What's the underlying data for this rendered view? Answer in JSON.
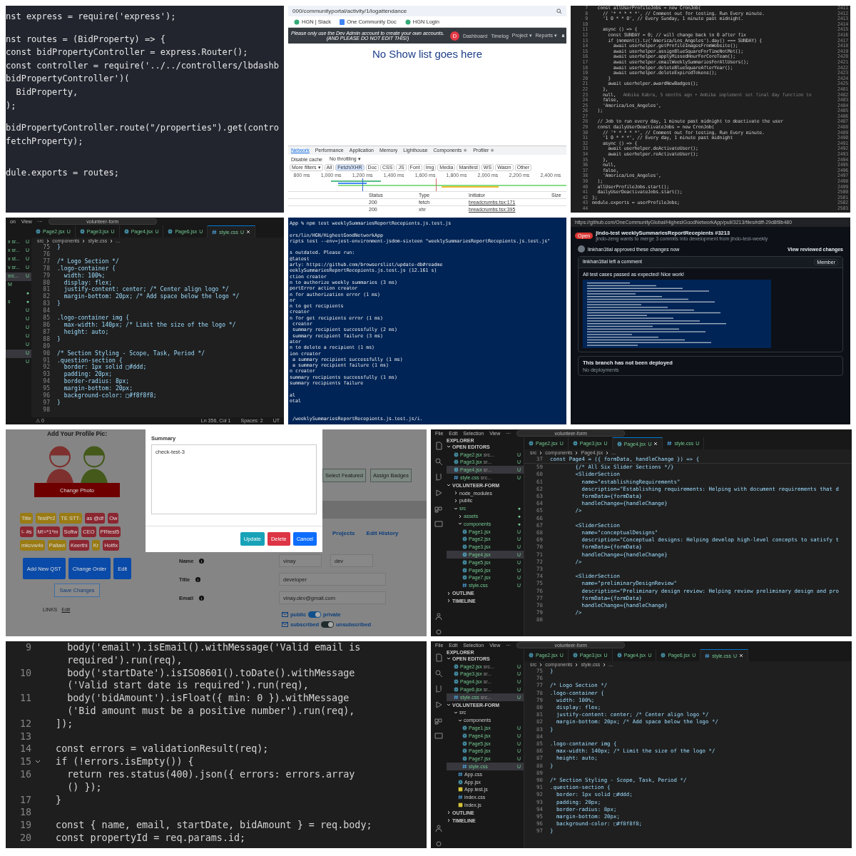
{
  "panels": [
    {
      "kind": "code",
      "lines": [
        {
          "text": "nst express = require('express');"
        },
        {
          "kind": "blank"
        },
        {
          "text": "nst routes = (BidProperty) => {"
        },
        {
          "text": "const bidPropertyController = express.Router();"
        },
        {
          "text": "const controller = require('../../controllers/lbdashb"
        },
        {
          "text": "bidPropertyController')("
        },
        {
          "text": "  BidProperty,"
        },
        {
          "text": ");"
        },
        {
          "kind": "blank"
        },
        {
          "text": "bidPropertyController.route(\"/properties\").get(contro"
        },
        {
          "text": "fetchProperty);"
        },
        {
          "kind": "blank"
        },
        {
          "kind": "blank"
        },
        {
          "text": "dule.exports = routes;"
        }
      ]
    },
    {
      "kind": "browser",
      "url": "000/communityportal/activity/1/logattendance",
      "bookmarks": [
        {
          "label": "HGN | Slack",
          "kind": "globe"
        },
        {
          "label": "One Community Doc",
          "kind": "doc"
        },
        {
          "label": "HGN Login",
          "kind": "globe"
        }
      ],
      "notice": [
        "Please only use the Dev Admin account to create your own accounts.",
        "(AND PLEASE DO NOT EDIT THIS!)"
      ],
      "avatar": "D",
      "nav": [
        "Dashboard",
        "Timelog",
        "Project ▾",
        "Reports ▾"
      ],
      "heading": "No Show list goes here",
      "devtools_tabs": [
        {
          "label": "Network",
          "selected": true
        },
        {
          "label": "Performance",
          "selected": false
        },
        {
          "label": "Application",
          "selected": false
        },
        {
          "label": "Memory",
          "selected": false
        },
        {
          "label": "Lighthouse",
          "selected": false
        },
        {
          "label": "Components ⚛",
          "selected": false
        },
        {
          "label": "Profiler ⚛",
          "selected": false
        }
      ],
      "toolbar": [
        "Disable cache",
        "No throttling ▾"
      ],
      "filters": [
        {
          "label": "More filters ▾",
          "selected": false
        },
        {
          "label": "All",
          "selected": false
        },
        {
          "label": "Fetch/XHR",
          "selected": true
        },
        {
          "label": "Doc",
          "selected": false
        },
        {
          "label": "CSS",
          "selected": false
        },
        {
          "label": "JS",
          "selected": false
        },
        {
          "label": "Font",
          "selected": false
        },
        {
          "label": "Img",
          "selected": false
        },
        {
          "label": "Media",
          "selected": false
        },
        {
          "label": "Manifest",
          "selected": false
        },
        {
          "label": "WS",
          "selected": false
        },
        {
          "label": "Wasm",
          "selected": false
        },
        {
          "label": "Other",
          "selected": false
        }
      ],
      "timeline": [
        "800 ms",
        "1,000 ms",
        "1,200 ms",
        "1,400 ms",
        "1,600 ms",
        "1,800 ms",
        "2,000 ms",
        "2,200 ms",
        "2,400 ms"
      ],
      "columns": [
        "Status",
        "Type",
        "Initiator",
        "Size"
      ],
      "rows": [
        [
          "200",
          "fetch",
          "breadcrumbs.tsx:171"
        ],
        [
          "200",
          "xhr",
          "breadcrumbs.tsx:395"
        ]
      ]
    },
    {
      "kind": "code",
      "lines": [
        {
          "n": "7",
          "text": "  const allUserProfileJobs = new CronJob(",
          "aux": "2411"
        },
        {
          "n": "8",
          "text": "    // '* * * * *', // Comment out for testing. Run Every minute.",
          "aux": "2412"
        },
        {
          "n": "9",
          "text": "    '1 0 * * 0', // Every Sunday, 1 minute past midnight.",
          "aux": "2413"
        },
        {
          "n": "10",
          "aux": "2414"
        },
        {
          "n": "11",
          "text": "    async () => {",
          "aux": "2415"
        },
        {
          "n": "12",
          "text": "      const SUNDAY = 0; // will change back to 0 after fix",
          "aux": "2416"
        },
        {
          "n": "13",
          "text": "      if (moment().tz('America/Los_Angeles').day() === SUNDAY) {",
          "aux": "2417"
        },
        {
          "n": "14",
          "text": "        await userhelper.getProfileImagesFromWebsite();",
          "aux": "2418"
        },
        {
          "n": "15",
          "text": "        await userhelper.assignBlueSquareForTimeNotMet();",
          "aux": "2419"
        },
        {
          "n": "16",
          "text": "        await userhelper.applyMissedHourForCoreTeam();",
          "aux": "2420"
        },
        {
          "n": "17",
          "text": "        await userhelper.emailWeeklySummariesForAllUsers();",
          "aux": "2421"
        },
        {
          "n": "18",
          "text": "        await userhelper.deleteBlueSquareAfterYear();",
          "aux": "2422"
        },
        {
          "n": "19",
          "text": "        await userhelper.deleteExpiredTokens();",
          "aux": "2423"
        },
        {
          "n": "20",
          "text": "      }",
          "aux": "2424"
        },
        {
          "n": "21",
          "text": "      await userhelper.awardNewBadges();",
          "aux": "2425"
        },
        {
          "n": "22",
          "text": "    },",
          "aux": "2481"
        },
        {
          "n": "23",
          "text": "    null,",
          "blame": "Ambika Kabra, 5 months ago • Ambika implement set final day function to",
          "aux": "2482"
        },
        {
          "n": "24",
          "text": "    false,",
          "aux": "2483"
        },
        {
          "n": "25",
          "text": "    'America/Los_Angeles',",
          "aux": "2484"
        },
        {
          "n": "26",
          "text": "  );",
          "aux": "2485"
        },
        {
          "n": "27",
          "aux": "2486"
        },
        {
          "n": "28",
          "text": "  // Job to run every day, 1 minute past midnight to deactivate the user",
          "aux": "2487"
        },
        {
          "n": "29",
          "text": "  const dailyUserDeactivateJobs = new CronJob(",
          "aux": "2488"
        },
        {
          "n": "30",
          "text": "    // '* * * * *', // Comment out for testing. Run Every minute.",
          "aux": "2489"
        },
        {
          "n": "31",
          "text": "    '1 0 * * *', // Every day, 1 minute past midnight",
          "aux": "2490"
        },
        {
          "n": "32",
          "text": "    async () => {",
          "aux": "2491"
        },
        {
          "n": "33",
          "text": "      await userhelper.deActivateUser();",
          "aux": "2492"
        },
        {
          "n": "34",
          "text": "      await userhelper.reActivateUser();",
          "aux": "2493"
        },
        {
          "n": "35",
          "text": "    },",
          "aux": "2494"
        },
        {
          "n": "36",
          "text": "    null,",
          "aux": "2495"
        },
        {
          "n": "37",
          "text": "    false,",
          "aux": "2496"
        },
        {
          "n": "38",
          "text": "    'America/Los_Angeles',",
          "aux": "2497"
        },
        {
          "n": "39",
          "text": "  );",
          "aux": "2498"
        },
        {
          "n": "40",
          "text": "  allUserProfileJobs.start();",
          "aux": "2499"
        },
        {
          "n": "41",
          "text": "  dailyUserDeactivateJobs.start();",
          "aux": "2500"
        },
        {
          "n": "42",
          "text": "};",
          "aux": "2501"
        },
        {
          "n": "43",
          "text": "module.exports = userProfileJobs;",
          "aux": "2502"
        },
        {
          "n": "44",
          "aux": "2503"
        }
      ]
    },
    {
      "kind": "editor",
      "menu": [
        "on",
        "View",
        "···"
      ],
      "search": "volunteer-form",
      "sidebar_strip": [
        {
          "text": "x sr...",
          "status": "U",
          "selected": false
        },
        {
          "text": "x sr...",
          "status": "U",
          "selected": false
        },
        {
          "text": "x st...",
          "status": "U",
          "selected": false
        },
        {
          "text": "v sr...",
          "status": "U",
          "selected": false
        },
        {
          "text": "src...",
          "status": "U",
          "selected": true
        },
        {
          "text": "M",
          "selected": false
        },
        {
          "status": "●",
          "selected": false
        },
        {
          "text": "s",
          "status": "●",
          "selected": false
        },
        {
          "status": "U",
          "selected": false
        },
        {
          "status": "U",
          "selected": false
        },
        {
          "status": "U",
          "selected": false
        },
        {
          "status": "U",
          "selected": false
        },
        {
          "status": "U",
          "selected": false
        },
        {
          "status": "U",
          "selected": true
        },
        {
          "status": "U",
          "selected": false
        }
      ],
      "tabs": [
        {
          "label": "Page2.jsx",
          "kind": "jsx",
          "status": "U",
          "selected": false
        },
        {
          "label": "Page3.jsx",
          "kind": "jsx",
          "status": "U",
          "selected": false
        },
        {
          "label": "Page4.jsx",
          "kind": "jsx",
          "status": "U",
          "selected": false
        },
        {
          "label": "Page6.jsx",
          "kind": "jsx",
          "status": "U",
          "selected": false
        },
        {
          "label": "style.css",
          "kind": "css",
          "status": "U",
          "selected": true
        }
      ],
      "breadcrumb": [
        "src",
        "components",
        "style.css",
        "..."
      ],
      "lines": [
        {
          "n": "75",
          "text": "}"
        },
        {
          "n": "76"
        },
        {
          "n": "77",
          "text": "/* Logo Section */"
        },
        {
          "n": "78",
          "text": ".logo-container {"
        },
        {
          "n": "79",
          "text": "  width: 100%;"
        },
        {
          "n": "80",
          "text": "  display: flex;"
        },
        {
          "n": "81",
          "text": "  justify-content: center; /* Center align logo */"
        },
        {
          "n": "82",
          "text": "  margin-bottom: 20px; /* Add space below the logo */"
        },
        {
          "n": "83",
          "text": "}"
        },
        {
          "n": "84"
        },
        {
          "n": "85",
          "text": ".logo-container img {"
        },
        {
          "n": "86",
          "text": "  max-width: 140px; /* Limit the size of the logo */"
        },
        {
          "n": "87",
          "text": "  height: auto;"
        },
        {
          "n": "88",
          "text": "}"
        },
        {
          "n": "89"
        },
        {
          "n": "90",
          "text": "/* Section Styling - Scope, Task, Period */"
        },
        {
          "n": "91",
          "text": ".question-section {"
        },
        {
          "n": "92",
          "text": "  border: 1px solid □#ddd;"
        },
        {
          "n": "93",
          "text": "  padding: 20px;"
        },
        {
          "n": "94",
          "text": "  border-radius: 8px;"
        },
        {
          "n": "95",
          "text": "  margin-bottom: 20px;"
        },
        {
          "n": "96",
          "text": "  background-color: □#f8f8f8;"
        },
        {
          "n": "97",
          "text": "}"
        },
        {
          "n": "98"
        }
      ],
      "status_bar": [
        "⚠ 0",
        "Ln 356, Col 1",
        "Spaces: 2",
        "UT"
      ]
    },
    {
      "kind": "terminal",
      "lines": [
        {
          "text": "App % npm test weeklySummariesReportRecepients.js.test.js"
        },
        {
          "kind": "blank"
        },
        {
          "text": "ers/lin/HGN/HighestGoodNetworkApp"
        },
        {
          "text": "ripts test --env=jest-environment-jsdom-sixteen \"weeklySummariesReportRecepients.js.test.js\""
        },
        {
          "kind": "blank"
        },
        {
          "text": "s outdated. Please run:"
        },
        {
          "text": "@latest"
        },
        {
          "text": "arly: https://github.com/browserslist/update-db#readme"
        },
        {
          "text": "eeklySummariesReportRecepients.js.test.js (12.161 s)"
        },
        {
          "text": "ction creator"
        },
        {
          "text": "n to authorize weekly summaries (3 ms)"
        },
        {
          "text": "portError action creator"
        },
        {
          "text": "n for authorization error (1 ms)"
        },
        {
          "text": "or"
        },
        {
          "text": "n to get recipients"
        },
        {
          "text": "creator"
        },
        {
          "text": "n for get recipients error (1 ms)"
        },
        {
          "text": " creator"
        },
        {
          "text": " summary recipient successfully (2 ms)"
        },
        {
          "text": " summary recipient failure (3 ms)"
        },
        {
          "text": "ator"
        },
        {
          "text": "n to delete a recipient (1 ms)"
        },
        {
          "text": "ion creator"
        },
        {
          "text": " a summary recipient successfully (1 ms)"
        },
        {
          "text": " a summary recipient failure (1 ms)"
        },
        {
          "text": "n creator"
        },
        {
          "text": "summary recipients successfully (1 ms)"
        },
        {
          "text": "summary recipients failure"
        },
        {
          "kind": "blank"
        },
        {
          "text": "al"
        },
        {
          "text": "otal"
        },
        {
          "kind": "blank"
        },
        {
          "kind": "blank"
        },
        {
          "text": " /weeklySummariesReportRecepients.js.test.js/i."
        }
      ]
    },
    {
      "kind": "github",
      "url": "https://github.com/OneCommunityGlobal/HighestGoodNetworkApp/pull/3213/files#diff-29d8f8b480",
      "state": "Open",
      "title": "jindo-test weeklySummariesReportRecepients #3213",
      "subtitle": "jindo-zeng wants to merge 3 commits into development from jindo-test-weekly",
      "approval": "linkhan1tial approved these changes now",
      "review_link": "View reviewed changes",
      "comment_author": "linkhan1tial left a comment",
      "role": "Member",
      "comment": "All test cases passed as expected! Nice work!",
      "deploy_title": "This branch has not been deployed",
      "deploy_sub": "No deployments"
    },
    {
      "kind": "profile",
      "pic_title": "Add Your Profile Pic:",
      "change_photo": "Change Photo",
      "tags": [
        {
          "label": "Title",
          "color": "#9a7b14"
        },
        {
          "label": "TestPr2",
          "color": "#9a7b14"
        },
        {
          "label": "TE STT-",
          "color": "#9a7b14"
        },
        {
          "label": "as @df",
          "color": "#8b2631"
        },
        {
          "label": "Ow",
          "color": "#8b2631"
        },
        {
          "label": "!- #s",
          "color": "#8b2631"
        },
        {
          "label": "M!=*1*m",
          "color": "#8b2631"
        },
        {
          "label": "Softw",
          "color": "#8b2631"
        },
        {
          "label": "CEO",
          "color": "#8b2631"
        },
        {
          "label": "PRtest5",
          "color": "#8b2631"
        },
        {
          "label": "mkcvw4x",
          "color": "#9a7b14"
        },
        {
          "label": "Pallavi",
          "color": "#9a7b14"
        },
        {
          "label": "Keerthi",
          "color": "#8b2631"
        },
        {
          "label": "Kr",
          "color": "#9a7b14"
        },
        {
          "label": "Hotfix",
          "color": "#8b2631"
        }
      ],
      "actions": [
        "Add New QST",
        "Change Order",
        "Edit"
      ],
      "save": "Save Changes",
      "links_label": "LINKS",
      "links_edit": "Edit",
      "top_buttons": [
        "Select Featured",
        "Assign Badges"
      ],
      "tabs": [
        "Projects",
        "Edit History"
      ],
      "fields": [
        {
          "label": "Name",
          "values": [
            "vinay",
            "dev"
          ]
        },
        {
          "label": "Title",
          "values": [
            "developer"
          ]
        },
        {
          "label": "Email",
          "values": [
            "vinay.dev@gmail.com"
          ]
        }
      ],
      "toggles": [
        {
          "left": "public",
          "right": "private",
          "on": true
        },
        {
          "left": "subscribed",
          "right": "unsubscribed",
          "on": true
        }
      ],
      "modal": {
        "title": "Summary",
        "value": "check-test-3",
        "buttons": [
          {
            "label": "Update",
            "kind": "info"
          },
          {
            "label": "Delete",
            "kind": "danger"
          },
          {
            "label": "Cancel",
            "kind": "primary"
          }
        ]
      }
    },
    {
      "kind": "editor",
      "menu": [
        "File",
        "Edit",
        "Selection",
        "View",
        "···"
      ],
      "search": "volunteer-form",
      "explorer": {
        "title": "EXPLORER",
        "sections": [
          {
            "label": "OPEN EDITORS",
            "expanded": true,
            "children": [
              {
                "label": "Page2.jsx",
                "hint": "src...",
                "kind": "jsx",
                "status": "U",
                "selected": false
              },
              {
                "label": "Page3.jsx",
                "hint": "sr...",
                "kind": "jsx",
                "status": "U",
                "selected": false
              },
              {
                "label": "Page4.jsx",
                "hint": "sr...",
                "kind": "jsx",
                "status": "U",
                "selected": true
              },
              {
                "label": "style.css",
                "hint": "src...",
                "kind": "css",
                "status": "U",
                "selected": false
              }
            ]
          },
          {
            "label": "VOLUNTEER-FORM",
            "expanded": true,
            "children": [
              {
                "label": "node_modules",
                "kind": "folder",
                "expanded": false
              },
              {
                "label": "public",
                "kind": "folder",
                "expanded": false
              },
              {
                "label": "src",
                "kind": "folder",
                "expanded": true,
                "status": "●",
                "children": [
                  {
                    "label": "assets",
                    "kind": "folder",
                    "expanded": false,
                    "status": "●"
                  },
                  {
                    "label": "components",
                    "kind": "folder",
                    "expanded": true,
                    "status": "●",
                    "children": [
                      {
                        "label": "Page1.jsx",
                        "kind": "jsx",
                        "status": "U",
                        "selected": false
                      },
                      {
                        "label": "Page2.jsx",
                        "kind": "jsx",
                        "status": "U",
                        "selected": false
                      },
                      {
                        "label": "Page3.jsx",
                        "kind": "jsx",
                        "status": "U",
                        "selected": false
                      },
                      {
                        "label": "Page4.jsx",
                        "kind": "jsx",
                        "status": "U",
                        "selected": true
                      },
                      {
                        "label": "Page5.jsx",
                        "kind": "jsx",
                        "status": "U",
                        "selected": false
                      },
                      {
                        "label": "Page6.jsx",
                        "kind": "jsx",
                        "status": "U",
                        "selected": false
                      },
                      {
                        "label": "Page7.jsx",
                        "kind": "jsx",
                        "status": "U",
                        "selected": false
                      },
                      {
                        "label": "style.css",
                        "kind": "css",
                        "status": "U",
                        "selected": false
                      }
                    ]
                  }
                ]
              }
            ]
          },
          {
            "label": "OUTLINE",
            "expanded": false
          },
          {
            "label": "TIMELINE",
            "expanded": false
          }
        ]
      },
      "tabs": [
        {
          "label": "Page2.jsx",
          "kind": "jsx",
          "status": "U",
          "selected": false
        },
        {
          "label": "Page3.jsx",
          "kind": "jsx",
          "status": "U",
          "selected": false
        },
        {
          "label": "Page4.jsx",
          "kind": "jsx",
          "status": "U",
          "selected": true
        },
        {
          "label": "style.css",
          "kind": "css",
          "status": "U",
          "selected": false
        }
      ],
      "breadcrumb": [
        "src",
        "components",
        "Page4.jsx",
        "..."
      ],
      "sticky": {
        "n": "37",
        "text": "const Page4 = ({ formData, handleChange }) => {"
      },
      "lines": [
        {
          "n": "59",
          "text": "        {/* All Six Slider Sections */}"
        },
        {
          "n": "60",
          "text": "        <SliderSection"
        },
        {
          "n": "61",
          "text": "          name=\"establishingRequirements\""
        },
        {
          "n": "62",
          "text": "          description=\"Establishing requirements: Helping with document requirements that d"
        },
        {
          "n": "63",
          "text": "          formData={formData}"
        },
        {
          "n": "64",
          "text": "          handleChange={handleChange}"
        },
        {
          "n": "65",
          "text": "        />"
        },
        {
          "n": "66"
        },
        {
          "n": "67",
          "text": "        <SliderSection"
        },
        {
          "n": "68",
          "text": "          name=\"conceptualDesigns\""
        },
        {
          "n": "69",
          "text": "          description=\"Conceptual designs: Helping develop high-level concepts to satisfy t"
        },
        {
          "n": "70",
          "text": "          formData={formData}"
        },
        {
          "n": "71",
          "text": "          handleChange={handleChange}"
        },
        {
          "n": "72",
          "text": "        />"
        },
        {
          "n": "73"
        },
        {
          "n": "74",
          "text": "        <SliderSection"
        },
        {
          "n": "75",
          "text": "          name=\"preliminaryDesignReview\""
        },
        {
          "n": "76",
          "text": "          description=\"Preliminary design review: Helping review preliminary design and pro"
        },
        {
          "n": "77",
          "text": "          formData={formData}"
        },
        {
          "n": "78",
          "text": "          handleChange={handleChange}"
        },
        {
          "n": "79",
          "text": "        />"
        },
        {
          "n": "80"
        }
      ]
    },
    {
      "kind": "code",
      "lines": [
        {
          "n": "9",
          "text": "    body('email').isEmail().withMessage('Valid email is"
        },
        {
          "text": "    required').run(req),"
        },
        {
          "n": "10",
          "text": "    body('startDate').isISO8601().toDate().withMessage"
        },
        {
          "text": "    ('Valid start date is required').run(req),"
        },
        {
          "n": "11",
          "text": "    body('bidAmount').isFloat({ min: 0 }).withMessage"
        },
        {
          "text": "    ('Bid amount must be a positive number').run(req),"
        },
        {
          "n": "12",
          "text": "  ]);"
        },
        {
          "n": "13"
        },
        {
          "n": "14",
          "text": "  const errors = validationResult(req);"
        },
        {
          "n": "15",
          "text": "  if (!errors.isEmpty()) {",
          "fold": true
        },
        {
          "n": "16",
          "text": "    return res.status(400).json({ errors: errors.array"
        },
        {
          "text": "    () });"
        },
        {
          "n": "17",
          "text": "  }"
        },
        {
          "n": "18"
        },
        {
          "n": "19",
          "text": "  const { name, email, startDate, bidAmount } = req.body;"
        },
        {
          "n": "20",
          "text": "  const propertyId = req.params.id;"
        }
      ]
    },
    {
      "kind": "editor",
      "menu": [
        "File",
        "Edit",
        "Selection",
        "View",
        "···"
      ],
      "search": "volunteer-form",
      "explorer": {
        "title": "EXPLORER",
        "sections": [
          {
            "label": "OPEN EDITORS",
            "expanded": true,
            "children": [
              {
                "label": "Page2.jsx",
                "hint": "src...",
                "kind": "jsx",
                "status": "U",
                "selected": false
              },
              {
                "label": "Page3.jsx",
                "hint": "sr...",
                "kind": "jsx",
                "status": "U",
                "selected": false
              },
              {
                "label": "Page4.jsx",
                "hint": "sr...",
                "kind": "jsx",
                "status": "U",
                "selected": false
              },
              {
                "label": "Page6.jsx",
                "hint": "sr...",
                "kind": "jsx",
                "status": "U",
                "selected": false
              },
              {
                "label": "style.css",
                "hint": "src...",
                "kind": "css",
                "status": "U",
                "selected": true
              }
            ]
          },
          {
            "label": "VOLUNTEER-FORM",
            "expanded": true,
            "children": [
              {
                "label": "src",
                "kind": "folder",
                "expanded": true,
                "children": [
                  {
                    "label": "components",
                    "kind": "folder",
                    "expanded": true,
                    "children": [
                      {
                        "label": "Page1.jsx",
                        "kind": "jsx",
                        "status": "U",
                        "selected": false
                      },
                      {
                        "label": "Page4.jsx",
                        "kind": "jsx",
                        "status": "U",
                        "selected": false
                      },
                      {
                        "label": "Page5.jsx",
                        "kind": "jsx",
                        "status": "U",
                        "selected": false
                      },
                      {
                        "label": "Page6.jsx",
                        "kind": "jsx",
                        "status": "U",
                        "selected": false
                      },
                      {
                        "label": "Page7.jsx",
                        "kind": "jsx",
                        "status": "U",
                        "selected": false
                      },
                      {
                        "label": "style.css",
                        "kind": "css",
                        "status": "U",
                        "selected": true
                      }
                    ]
                  },
                  {
                    "label": "App.css",
                    "kind": "css",
                    "selected": false
                  },
                  {
                    "label": "App.jsx",
                    "kind": "jsx",
                    "selected": false
                  },
                  {
                    "label": "App.test.js",
                    "kind": "js",
                    "selected": false
                  },
                  {
                    "label": "index.css",
                    "kind": "css",
                    "selected": false
                  },
                  {
                    "label": "index.js",
                    "kind": "js",
                    "selected": false
                  }
                ]
              }
            ]
          },
          {
            "label": "OUTLINE",
            "expanded": false
          },
          {
            "label": "TIMELINE",
            "expanded": false
          }
        ]
      },
      "tabs": [
        {
          "label": "Page2.jsx",
          "kind": "jsx",
          "status": "U",
          "selected": false
        },
        {
          "label": "Page3.jsx",
          "kind": "jsx",
          "status": "U",
          "selected": false
        },
        {
          "label": "Page4.jsx",
          "kind": "jsx",
          "status": "U",
          "selected": false
        },
        {
          "label": "Page6.jsx",
          "kind": "jsx",
          "status": "U",
          "selected": false
        },
        {
          "label": "style.css",
          "kind": "css",
          "status": "U",
          "selected": true
        }
      ],
      "breadcrumb": [
        "src",
        "components",
        "style.css",
        "..."
      ],
      "lines": [
        {
          "n": "75",
          "text": "}"
        },
        {
          "n": "76"
        },
        {
          "n": "77",
          "text": "/* Logo Section */"
        },
        {
          "n": "78",
          "text": ".logo-container {"
        },
        {
          "n": "79",
          "text": "  width: 100%;"
        },
        {
          "n": "80",
          "text": "  display: flex;"
        },
        {
          "n": "81",
          "text": "  justify-content: center; /* Center align logo */"
        },
        {
          "n": "82",
          "text": "  margin-bottom: 20px; /* Add space below the logo */"
        },
        {
          "n": "83",
          "text": "}"
        },
        {
          "n": "84"
        },
        {
          "n": "85",
          "text": ".logo-container img {"
        },
        {
          "n": "86",
          "text": "  max-width: 140px; /* Limit the size of the logo */"
        },
        {
          "n": "87",
          "text": "  height: auto;"
        },
        {
          "n": "88",
          "text": "}"
        },
        {
          "n": "89"
        },
        {
          "n": "90",
          "text": "/* Section Styling - Scope, Task, Period */"
        },
        {
          "n": "91",
          "text": ".question-section {"
        },
        {
          "n": "92",
          "text": "  border: 1px solid □#ddd;"
        },
        {
          "n": "93",
          "text": "  padding: 20px;"
        },
        {
          "n": "94",
          "text": "  border-radius: 8px;"
        },
        {
          "n": "95",
          "text": "  margin-bottom: 20px;"
        },
        {
          "n": "96",
          "text": "  background-color: □#f8f8f8;"
        },
        {
          "n": "97",
          "text": "}"
        }
      ]
    }
  ]
}
